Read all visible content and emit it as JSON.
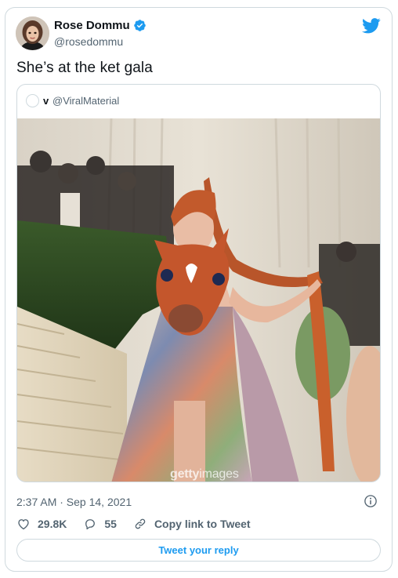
{
  "author": {
    "name": "Rose Dommu",
    "handle": "@rosedommu",
    "avatar_icon": "profile-photo",
    "verified_icon": "verified-badge-icon"
  },
  "brand_icon": "twitter-bird-icon",
  "tweet": {
    "text": "She’s at the ket gala",
    "timestamp": "2:37 AM · Sep 14, 2021"
  },
  "quoted": {
    "name": "v",
    "handle": "@ViralMaterial",
    "media_watermark_bold": "getty",
    "media_watermark_thin": "images"
  },
  "actions": {
    "likes": "29.8K",
    "replies": "55",
    "copy_link": "Copy link to Tweet"
  },
  "reply_button": "Tweet your reply",
  "colors": {
    "accent": "#1d9bf0",
    "text": "#0f1419",
    "muted": "#536471",
    "border": "#cfd9de"
  }
}
